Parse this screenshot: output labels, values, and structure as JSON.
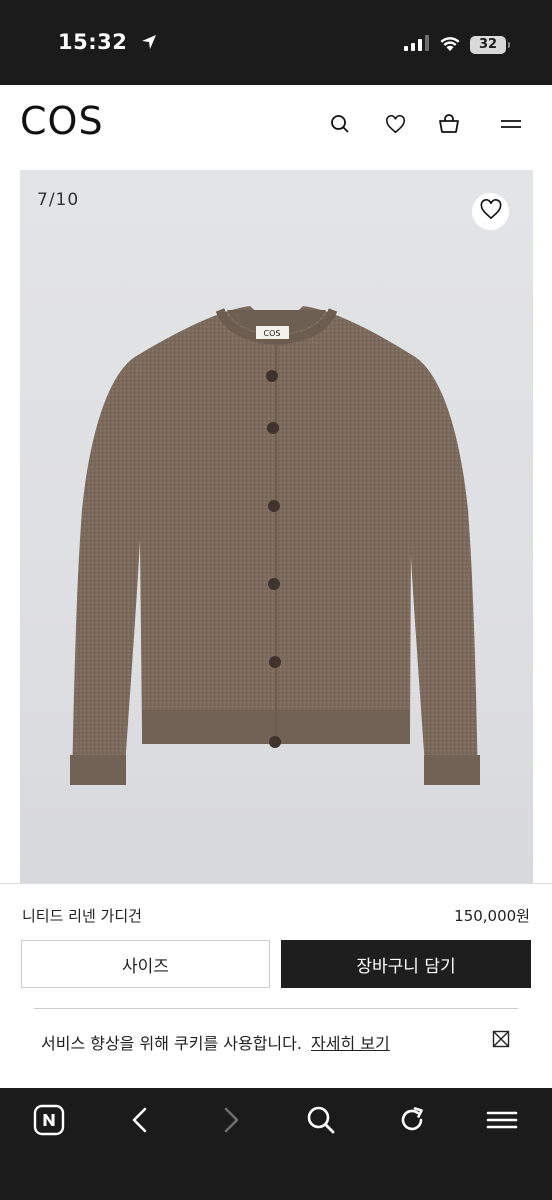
{
  "status_bar": {
    "time": "15:32",
    "battery": "32",
    "icons": [
      "location-arrow-icon",
      "signal-bars-icon",
      "wifi-icon",
      "battery-icon"
    ]
  },
  "header": {
    "logo": "COS",
    "icons": [
      "search-icon",
      "heart-icon",
      "bag-icon",
      "menu-icon"
    ]
  },
  "gallery": {
    "counter": "7/10",
    "garment_label": "COS",
    "wishlist_icon": "heart-icon"
  },
  "product": {
    "name": "니티드 리넨 가디건",
    "price": "150,000원"
  },
  "actions": {
    "size_label": "사이즈",
    "cart_label": "장바구니 담기"
  },
  "cookie_banner": {
    "text": "서비스 향상을 위해 쿠키를 사용합니다.",
    "link": "자세히 보기",
    "close_icon": "close-box-icon"
  },
  "browser_toolbar": {
    "icons": [
      "naver-home-icon",
      "back-arrow-icon",
      "forward-arrow-icon",
      "search-icon",
      "refresh-icon",
      "menu-icon"
    ]
  },
  "colors": {
    "status_bar": "#1b1b1b",
    "image_bg": "#e0e1e3",
    "cardigan": "#7e6d5f",
    "button_dark": "#1e1e1e"
  }
}
